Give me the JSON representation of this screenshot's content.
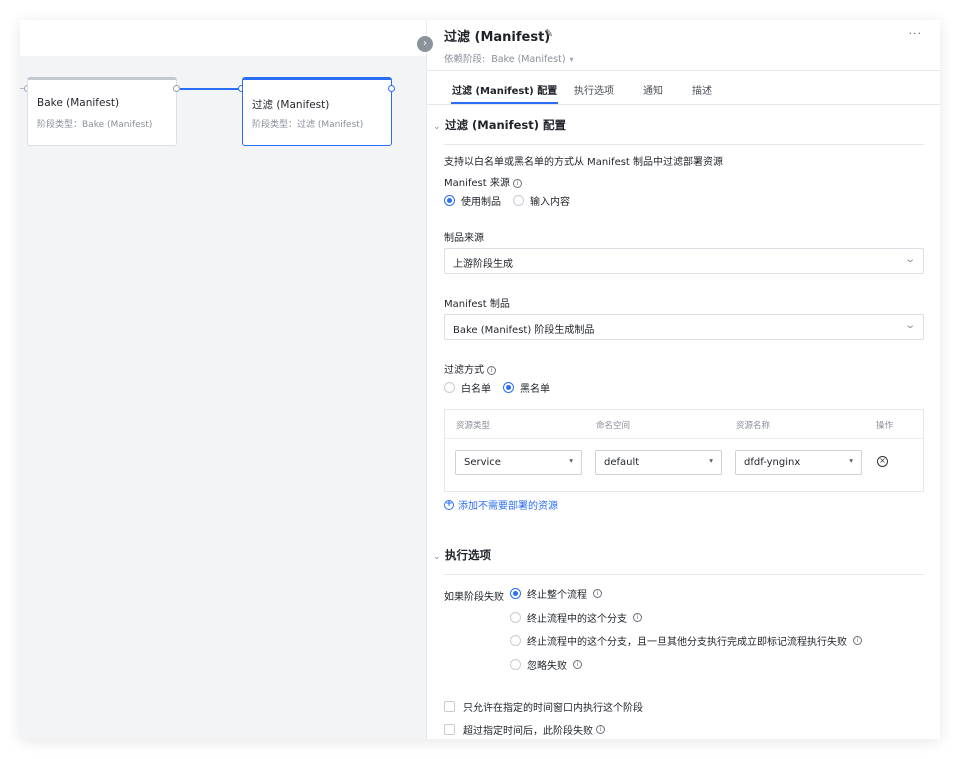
{
  "canvas": {
    "nodes": [
      {
        "title": "Bake (Manifest)",
        "subtitle": "阶段类型：Bake (Manifest)"
      },
      {
        "title": "过滤 (Manifest)",
        "subtitle": "阶段类型：过滤 (Manifest)"
      }
    ],
    "toggle_icon": "chevron-right-icon",
    "toggle_glyph": "›"
  },
  "panel": {
    "title": "过滤 (Manifest)",
    "edit_glyph": "✎",
    "more_glyph": "···",
    "dependency": {
      "label": "依赖阶段:",
      "value": "Bake (Manifest)",
      "caret": "▾"
    },
    "tabs": [
      {
        "label": "过滤 (Manifest) 配置",
        "active": true
      },
      {
        "label": "执行选项",
        "active": false
      },
      {
        "label": "通知",
        "active": false
      },
      {
        "label": "描述",
        "active": false
      }
    ]
  },
  "config": {
    "chev": "⌄",
    "section_title": "过滤 (Manifest) 配置",
    "description": "支持以白名单或黑名单的方式从 Manifest 制品中过滤部署资源",
    "source_label": "Manifest 来源",
    "source_options": [
      "使用制品",
      "输入内容"
    ],
    "source_selected": 0,
    "artifact_source_label": "制品来源",
    "artifact_source_value": "上游阶段生成",
    "manifest_artifact_label": "Manifest 制品",
    "manifest_artifact_value": "Bake (Manifest) 阶段生成制品",
    "filter_mode_label": "过滤方式",
    "filter_modes": [
      "白名单",
      "黑名单"
    ],
    "filter_selected": 1,
    "table": {
      "headers": [
        "资源类型",
        "命名空间",
        "资源名称",
        "操作"
      ],
      "row": [
        "Service",
        "default",
        "dfdf-ynginx"
      ],
      "caret": "▾",
      "delete_glyph": "×"
    },
    "add_link": "添加不需要部署的资源",
    "add_glyph": "+",
    "select_arrow": "⌄"
  },
  "exec": {
    "section_title": "执行选项",
    "on_fail_label": "如果阶段失败",
    "on_fail_options": [
      "终止整个流程",
      "终止流程中的这个分支",
      "终止流程中的这个分支，且一旦其他分支执行完成立即标记流程执行失败",
      "忽略失败"
    ],
    "on_fail_selected": 0,
    "checkboxes": [
      "只允许在指定的时间窗口内执行这个阶段",
      "超过指定时间后，此阶段失败"
    ],
    "info_glyph": "i"
  }
}
